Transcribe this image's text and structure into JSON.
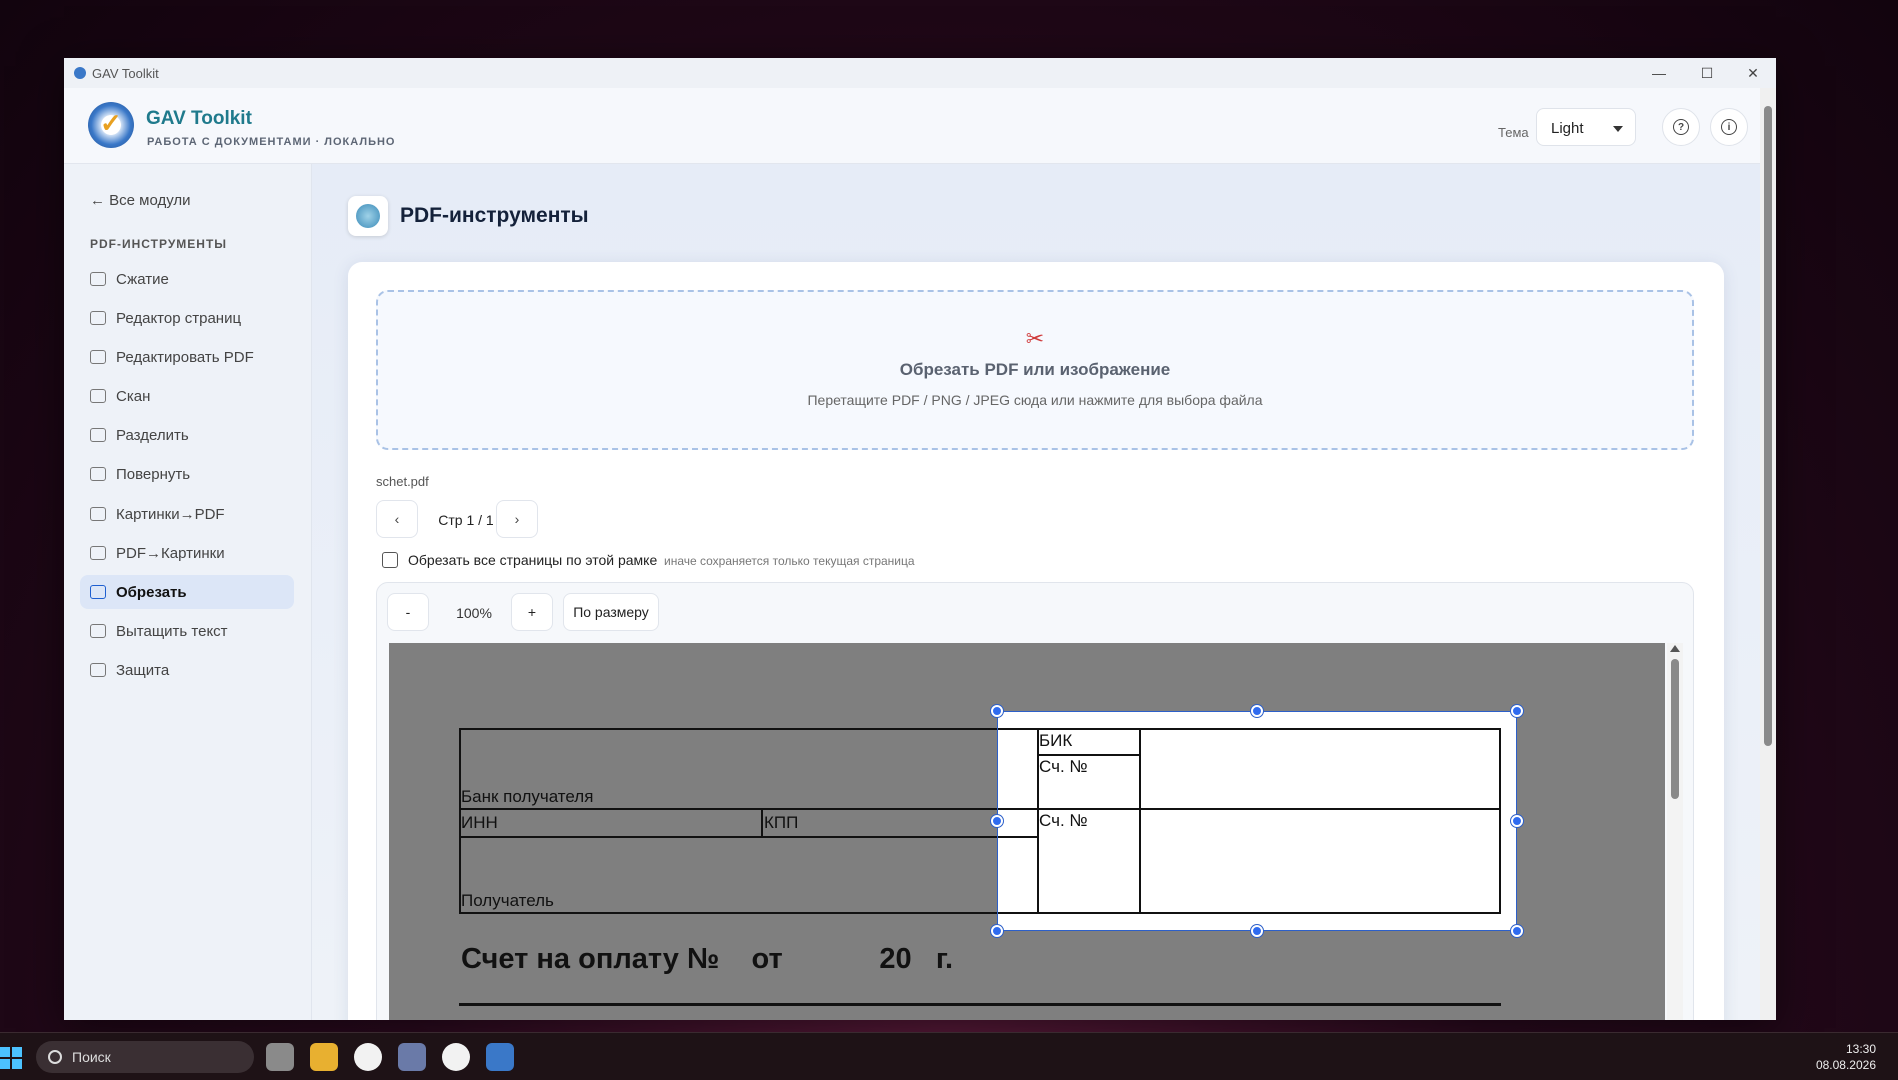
{
  "window": {
    "title": "GAV Toolkit"
  },
  "header": {
    "brand": "GAV Toolkit",
    "subtitle": "РАБОТА С ДОКУМЕНТАМИ · ЛОКАЛЬНО",
    "theme_label": "Тема",
    "theme_value": "Light"
  },
  "sidebar": {
    "back": "← Все модули",
    "section": "PDF-ИНСТРУМЕНТЫ",
    "items": [
      {
        "label": "Сжатие",
        "icon": "compress-icon"
      },
      {
        "label": "Редактор страниц",
        "icon": "grid-icon"
      },
      {
        "label": "Редактировать PDF",
        "icon": "edit-icon"
      },
      {
        "label": "Скан",
        "icon": "scan-icon"
      },
      {
        "label": "Разделить",
        "icon": "scissors-icon"
      },
      {
        "label": "Повернуть",
        "icon": "rotate-icon"
      },
      {
        "label": "Картинки→PDF",
        "icon": "image-icon"
      },
      {
        "label": "PDF→Картинки",
        "icon": "image-icon"
      },
      {
        "label": "Обрезать",
        "icon": "crop-icon",
        "active": true
      },
      {
        "label": "Вытащить текст",
        "icon": "text-icon"
      },
      {
        "label": "Защита",
        "icon": "lock-icon"
      }
    ]
  },
  "main": {
    "title": "PDF-инструменты",
    "drop_title": "Обрезать PDF или изображение",
    "drop_desc": "Перетащите PDF / PNG / JPEG сюда или нажмите для выбора файла",
    "file_name": "schet.pdf",
    "prev": "‹",
    "next": "›",
    "page_label": "Стр 1 / 1",
    "checkbox_label": "Обрезать все страницы по этой рамке",
    "checkbox_hint": "иначе сохраняется только текущая страница",
    "checkbox_checked": false,
    "zoom_out": "-",
    "zoom_level": "100%",
    "zoom_in": "+",
    "fit": "По размеру"
  },
  "document": {
    "bik": "БИК",
    "acc1": "Сч. №",
    "acc2": "Сч. №",
    "bank": "Банк получателя",
    "inn": "ИНН",
    "kpp": "КПП",
    "recipient": "Получатель",
    "invoice_title": "Счет на оплату №    от            20   г."
  },
  "taskbar": {
    "search": "Поиск",
    "time": "13:30",
    "date": "08.08.2026"
  },
  "colors": {
    "accent": "#2c5fc9",
    "brand": "#1f7a8c",
    "active_bg": "#dce6f7"
  }
}
